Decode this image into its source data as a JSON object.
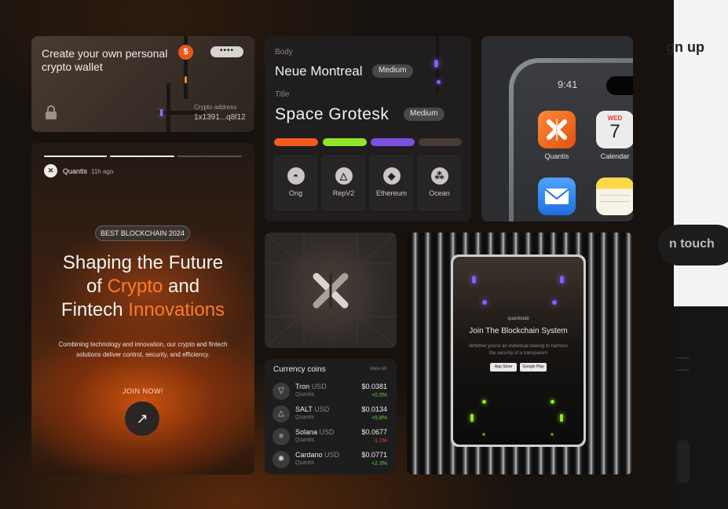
{
  "peek": {
    "signup": "gn up",
    "touch": "n touch"
  },
  "wallet": {
    "title": "Create your own personal crypto wallet",
    "badge": "$",
    "more": "••••",
    "address_label": "Crypto address",
    "address_value": "1x1391...q8l12"
  },
  "typography": {
    "body_label": "Body",
    "body_font": "Neue Montreal",
    "body_weight": "Medium",
    "title_label": "Title",
    "title_font": "Space Grotesk",
    "title_weight": "Medium",
    "swatches": [
      "#f35b1d",
      "#8fe628",
      "#7b4fe0",
      "#4a3a33"
    ],
    "tokens": [
      {
        "label": "Ong",
        "icon": "ong-icon"
      },
      {
        "label": "RepV2",
        "icon": "repv2-icon"
      },
      {
        "label": "Ethereum",
        "icon": "ethereum-icon"
      },
      {
        "label": "Ocean",
        "icon": "ocean-icon"
      }
    ]
  },
  "phone": {
    "time": "9:41",
    "apps": [
      {
        "label": "Quantis",
        "icon": "quantis-app-icon"
      },
      {
        "label": "Calendar",
        "day": "WED",
        "date": "7",
        "icon": "calendar-app-icon"
      },
      {
        "label": "",
        "icon": "mail-app-icon"
      },
      {
        "label": "",
        "icon": "notes-app-icon"
      }
    ]
  },
  "coins": {
    "title": "Currency coins",
    "view_all": "View All",
    "rows": [
      {
        "name": "Tron",
        "unit": "USD",
        "sub": "Quantis",
        "price": "$0.0381",
        "change": "+0.5%",
        "up": true,
        "icon": "tron-icon"
      },
      {
        "name": "SALT",
        "unit": "USD",
        "sub": "Quantis",
        "price": "$0.0134",
        "change": "+5.8%",
        "up": true,
        "icon": "salt-icon"
      },
      {
        "name": "Solana",
        "unit": "USD",
        "sub": "Quantis",
        "price": "$0.0677",
        "change": "-1.1%",
        "up": false,
        "icon": "solana-icon"
      },
      {
        "name": "Cardano",
        "unit": "USD",
        "sub": "Quantis",
        "price": "$0.0771",
        "change": "+2.3%",
        "up": true,
        "icon": "cardano-icon"
      }
    ]
  },
  "promo": {
    "user": "Quantis",
    "time": "11h ago",
    "badge": "BEST BLOCKCHAIN 2024",
    "headline_1": "Shaping the Future",
    "headline_2a": "of ",
    "headline_2b": "Crypto",
    "headline_2c": " and",
    "headline_3a": "Fintech ",
    "headline_3b": "Innovations",
    "description": "Combining technology and innovation, our crypto and fintech solutions deliver control, security, and efficiency.",
    "cta": "JOIN NOW!",
    "cta_icon": "↗"
  },
  "tablet": {
    "brand": "quantislab",
    "title": "Join The Blockchain System",
    "subtitle": "Whether you're an individual looking to harness the security of a transparent",
    "store_1": "App Store",
    "store_2": "Google Play"
  },
  "colors": {
    "accent": "#ff7a29",
    "up": "#5fd33b",
    "down": "#ef4a3a",
    "purple": "#8a5cff",
    "green": "#8fe628"
  }
}
